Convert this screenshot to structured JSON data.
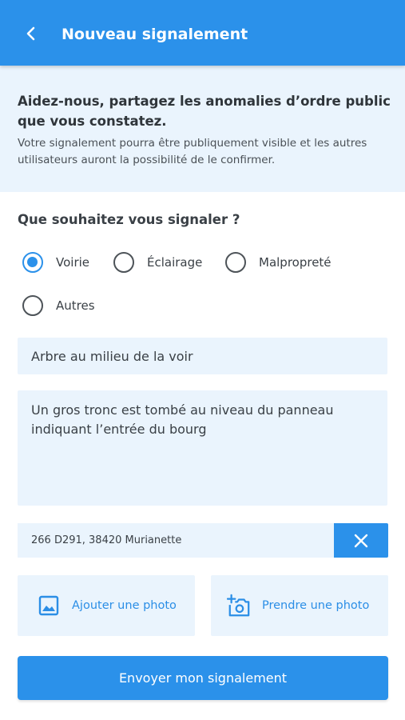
{
  "colors": {
    "primary": "#2b91ea",
    "surface": "#eaf4fd",
    "text": "#333a40"
  },
  "header": {
    "title": "Nouveau signalement",
    "back_icon": "chevron-left-icon"
  },
  "intro": {
    "title": "Aidez-nous, partagez les anomalies d’ordre public que vous constatez.",
    "text": "Votre signalement pourra être publiquement visible et les autres utilisateurs auront la possibilité de le confirmer."
  },
  "form": {
    "question": "Que souhaitez vous signaler ?",
    "categories": [
      {
        "label": "Voirie",
        "checked": true
      },
      {
        "label": "Éclairage",
        "checked": false
      },
      {
        "label": "Malpropreté",
        "checked": false
      },
      {
        "label": "Autres",
        "checked": false
      }
    ],
    "title_value": "Arbre au milieu de la voir",
    "description_value": "Un gros tronc est tombé au niveau du panneau indiquant l’entrée du bourg",
    "address_value": "266 D291, 38420 Murianette",
    "clear_icon": "close-icon",
    "add_photo_label": "Ajouter une photo",
    "add_photo_icon": "image-icon",
    "take_photo_label": "Prendre une photo",
    "take_photo_icon": "add-camera-icon",
    "submit_label": "Envoyer mon signalement"
  }
}
